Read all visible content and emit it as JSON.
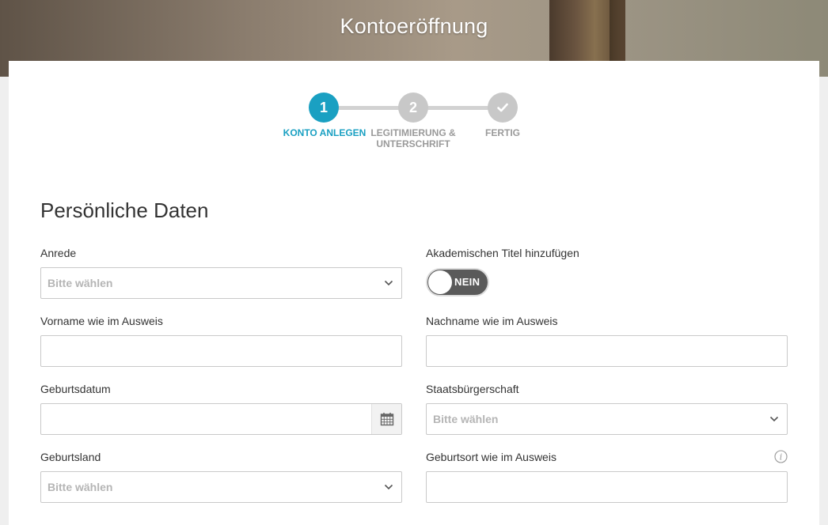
{
  "header": {
    "title": "Kontoeröffnung"
  },
  "stepper": {
    "steps": [
      {
        "number": "1",
        "label": "KONTO ANLEGEN"
      },
      {
        "number": "2",
        "label_line1": "LEGITIMIERUNG &",
        "label_line2": "UNTERSCHRIFT"
      },
      {
        "number": "",
        "label": "FERTIG"
      }
    ]
  },
  "section": {
    "title": "Persönliche Daten"
  },
  "form": {
    "anrede": {
      "label": "Anrede",
      "placeholder": "Bitte wählen"
    },
    "titel": {
      "label": "Akademischen Titel hinzufügen",
      "toggle_state": "NEIN"
    },
    "vorname": {
      "label": "Vorname wie im Ausweis",
      "value": ""
    },
    "nachname": {
      "label": "Nachname wie im Ausweis",
      "value": ""
    },
    "geburtsdatum": {
      "label": "Geburtsdatum",
      "value": ""
    },
    "staatsbuergerschaft": {
      "label": "Staatsbürgerschaft",
      "placeholder": "Bitte wählen"
    },
    "geburtsland": {
      "label": "Geburtsland",
      "placeholder": "Bitte wählen"
    },
    "geburtsort": {
      "label": "Geburtsort wie im Ausweis",
      "value": ""
    }
  },
  "colors": {
    "accent": "#1aa0c2",
    "inactive_step": "#c8c8c8",
    "toggle_bg": "#5a5a5a"
  }
}
